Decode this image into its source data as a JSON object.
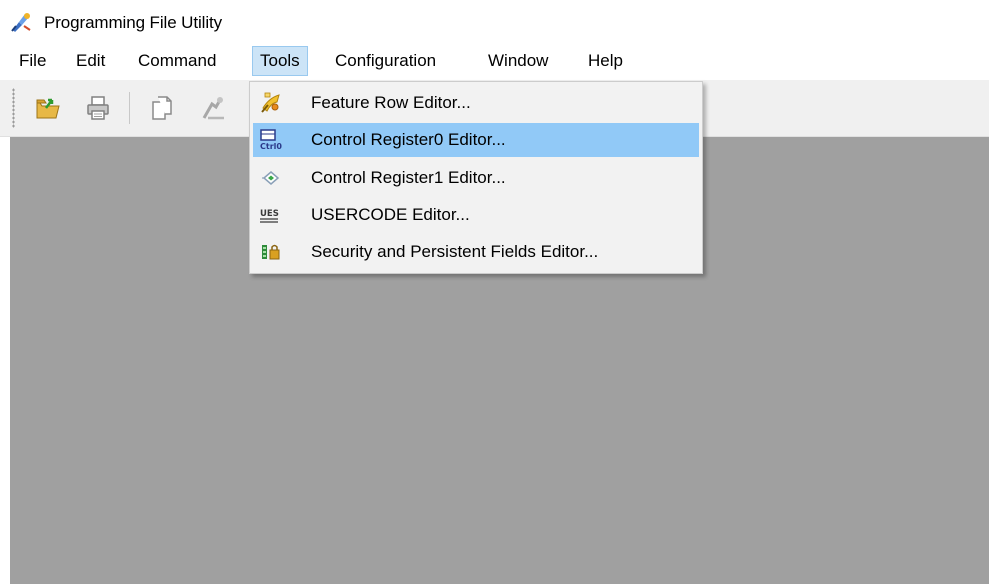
{
  "window": {
    "title": "Programming File Utility"
  },
  "menubar": {
    "items": [
      {
        "label": "File"
      },
      {
        "label": "Edit"
      },
      {
        "label": "Command"
      },
      {
        "label": "Tools",
        "open": true
      },
      {
        "label": "Configuration"
      },
      {
        "label": "Window"
      },
      {
        "label": "Help"
      }
    ]
  },
  "toolbar": {
    "buttons": [
      {
        "icon": "open-folder-icon"
      },
      {
        "icon": "print-icon"
      },
      {
        "icon": "copy-icon"
      },
      {
        "icon": "program-icon"
      }
    ]
  },
  "tools_menu": {
    "items": [
      {
        "label": "Feature Row Editor...",
        "icon": "feature-row-icon",
        "highlighted": false
      },
      {
        "label": "Control Register0 Editor...",
        "icon": "ctrl0-register-icon",
        "highlighted": true
      },
      {
        "label": "Control Register1 Editor...",
        "icon": "ctrl1-register-icon",
        "highlighted": false
      },
      {
        "label": "USERCODE Editor...",
        "icon": "usercode-icon",
        "highlighted": false
      },
      {
        "label": "Security and Persistent Fields Editor...",
        "icon": "security-fields-icon",
        "highlighted": false
      }
    ]
  },
  "colors": {
    "client_background": "#a0a0a0",
    "menu_highlight": "#91c9f7",
    "open_menu_background": "#cce4f7"
  }
}
